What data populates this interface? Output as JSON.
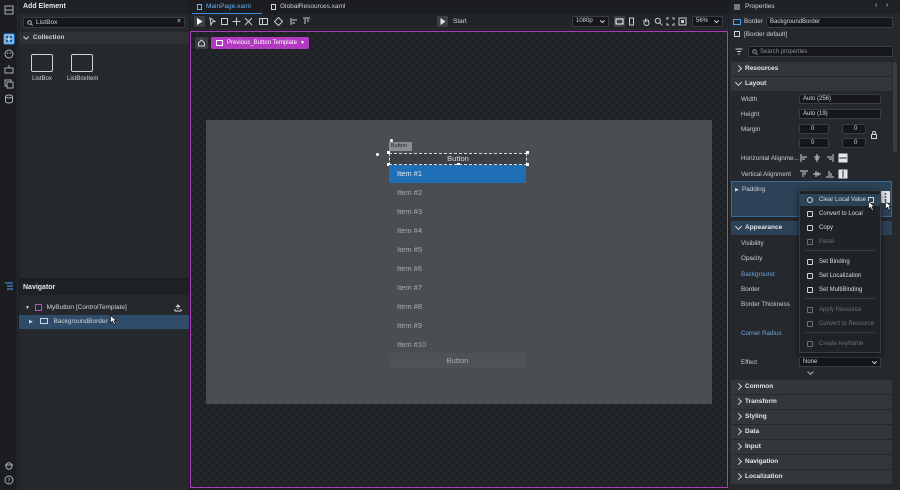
{
  "activity_bar": {
    "icons": [
      "layers-icon",
      "add-element-icon",
      "palette-icon",
      "cake-icon",
      "copy-icon",
      "database-icon",
      "navigator-icon",
      "bug-icon",
      "help-icon"
    ]
  },
  "add_element": {
    "title": "Add Element",
    "search_value": "ListBox",
    "collection_label": "Collection",
    "tiles": [
      {
        "label": "ListBox"
      },
      {
        "label": "ListBoxItem"
      }
    ]
  },
  "navigator": {
    "title": "Navigator",
    "root_label": "MyButton [ControlTemplate]",
    "child_label": "BackgroundBorder"
  },
  "tabs": [
    {
      "label": "MainPage.xaml",
      "active": true
    },
    {
      "label": "GlobalResources.xaml",
      "active": false
    }
  ],
  "toolbar": {
    "start_label": "Start",
    "resolution": "1080p",
    "zoom": "56%"
  },
  "designer": {
    "breadcrumb": "Previous_Button Template",
    "tag_label": "Button",
    "top_button_label": "Button",
    "items": [
      "Item #1",
      "Item #2",
      "Item #3",
      "Item #4",
      "Item #5",
      "Item #6",
      "Item #7",
      "Item #8",
      "Item #9",
      "Item #10"
    ],
    "selected_item": 0,
    "bottom_button_label": "Button",
    "colors": {
      "selection_border": "#b339c0",
      "item_selected": "#1e6fb5"
    }
  },
  "properties": {
    "title": "Properties",
    "type_label": "Border",
    "name_value": "BackgroundBorder",
    "style_label": "[Border default]",
    "search_placeholder": "Search properties",
    "sections_top": [
      "Resources",
      "Layout"
    ],
    "layout": {
      "width_label": "Width",
      "width_value": "Auto (256)",
      "height_label": "Height",
      "height_value": "Auto (19)",
      "margin_label": "Margin",
      "margin_values": [
        "0",
        "0",
        "0",
        "0"
      ],
      "halign_label": "Horizontal Alignme...",
      "valign_label": "Vertical Alignment",
      "padding_label": "Padding"
    },
    "appearance": {
      "title": "Appearance",
      "labels": [
        "Visibility",
        "Opacity",
        "Background",
        "Border",
        "Border Thickness",
        "Corner Radius"
      ],
      "effect_label": "Effect",
      "effect_value": "None"
    },
    "sections_bottom": [
      "Common",
      "Transform",
      "Styling",
      "Data",
      "Input",
      "Navigation",
      "Localization"
    ]
  },
  "context_menu": {
    "items": [
      {
        "label": "Clear Local Value",
        "icon": "clear-icon",
        "enabled": true,
        "highlighted": true
      },
      {
        "label": "Convert to Local",
        "icon": "convert-icon",
        "enabled": true
      },
      {
        "label": "Copy",
        "icon": "copy-icon",
        "enabled": true
      },
      {
        "label": "Paste",
        "icon": "paste-icon",
        "enabled": false
      },
      {
        "label": "Set Binding",
        "icon": "link-icon",
        "enabled": true
      },
      {
        "label": "Set Localization",
        "icon": "localization-icon",
        "enabled": true
      },
      {
        "label": "Set MultiBinding",
        "icon": "multibinding-icon",
        "enabled": true
      },
      {
        "label": "Apply Resource",
        "icon": "apply-resource-icon",
        "enabled": false
      },
      {
        "label": "Convert to Resource",
        "icon": "convert-resource-icon",
        "enabled": false
      },
      {
        "label": "Create keyframe",
        "icon": "keyframe-icon",
        "enabled": false
      }
    ]
  }
}
